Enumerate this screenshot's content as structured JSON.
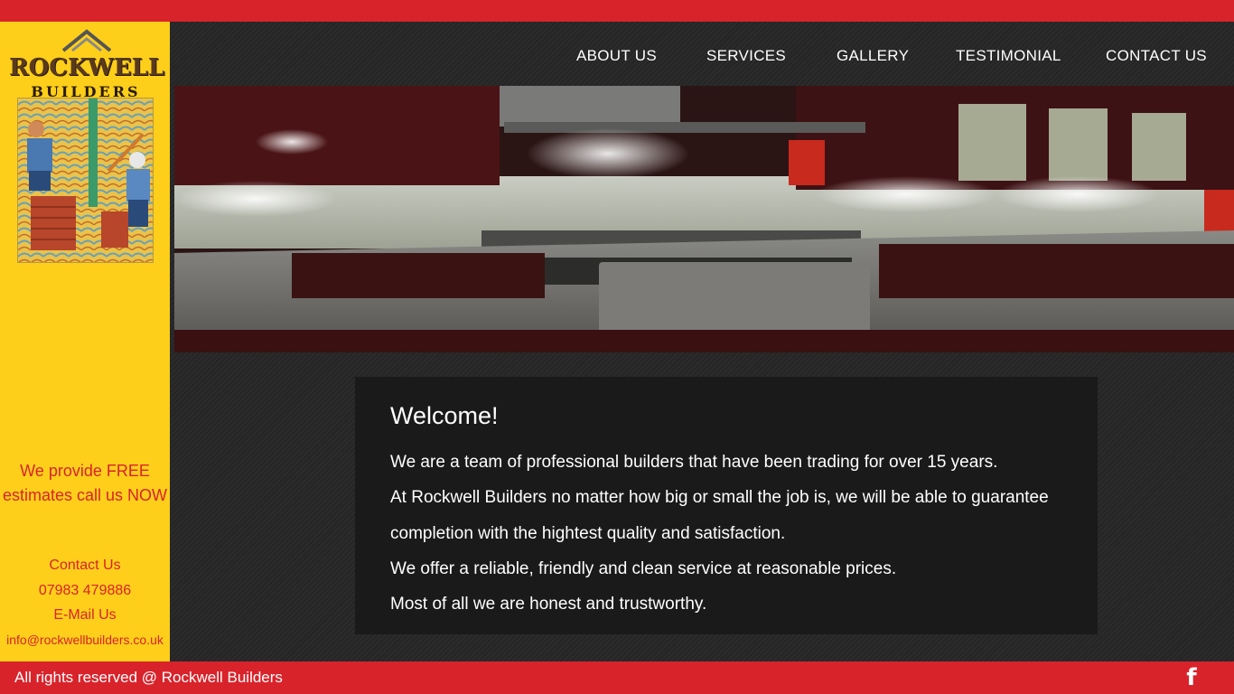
{
  "brand": {
    "name": "ROCKWELL",
    "sub": "BUILDERS"
  },
  "nav": {
    "items": [
      {
        "label": "ABOUT US"
      },
      {
        "label": "SERVICES"
      },
      {
        "label": "GALLERY"
      },
      {
        "label": "TESTIMONIAL"
      },
      {
        "label": "CONTACT US"
      }
    ]
  },
  "sidebar": {
    "promo_line1": "We provide FREE",
    "promo_line2": "estimates call us NOW",
    "contact_heading": "Contact Us",
    "phone": "07983 479886",
    "email_label": "E-Mail Us",
    "email": "info@rockwellbuilders.co.uk"
  },
  "welcome": {
    "title": "Welcome!",
    "lines": [
      "We are a team of professional builders that have been trading for over 15 years.",
      "At Rockwell Builders no matter how big or small the job is, we will be able to  guarantee",
      "completion with the hightest quality and satisfaction.",
      "We offer a reliable, friendly and clean service at reasonable prices.",
      "Most of all we are honest and trustworthy."
    ]
  },
  "footer": {
    "copyright": "All rights reserved @ Rockwell Builders",
    "facebook_glyph": "f"
  },
  "colors": {
    "accent_red": "#d9232b",
    "sidebar_yellow": "#fdcf1a",
    "background": "#262626",
    "panel": "#1a1a1a"
  },
  "icons": {
    "facebook": "facebook-icon",
    "roof": "roof-icon"
  }
}
